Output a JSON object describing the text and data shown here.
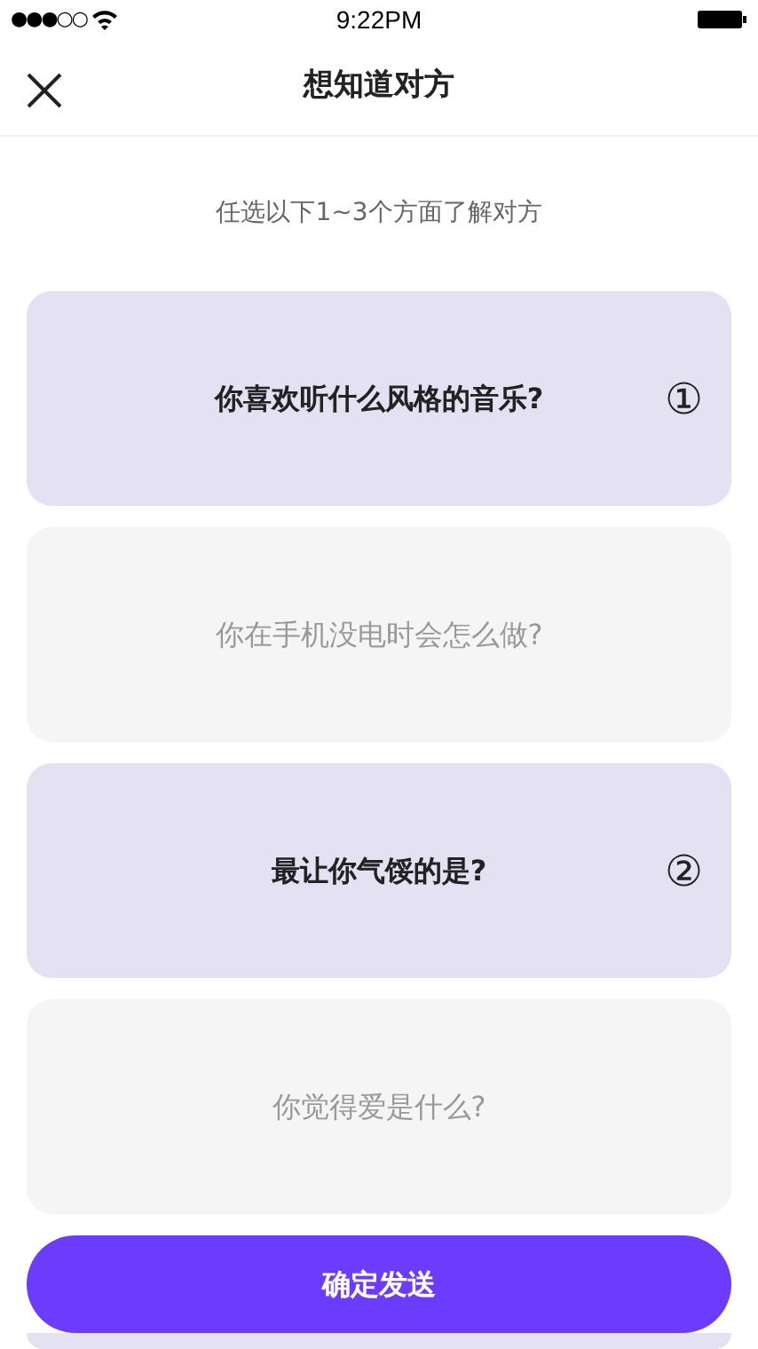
{
  "status_bar": {
    "signal_dots": "●●●○○",
    "time": "9:22PM"
  },
  "header": {
    "title": "想知道对方"
  },
  "subtitle": "任选以下1~3个方面了解对方",
  "cards": [
    {
      "question": "你喜欢听什么风格的音乐?",
      "selected": true,
      "order": "①"
    },
    {
      "question": "你在手机没电时会怎么做?",
      "selected": false
    },
    {
      "question": "最让你气馁的是?",
      "selected": true,
      "order": "②"
    },
    {
      "question": "你觉得爱是什么?",
      "selected": false
    },
    {
      "selected": true
    }
  ],
  "confirm_button": "确定发送"
}
